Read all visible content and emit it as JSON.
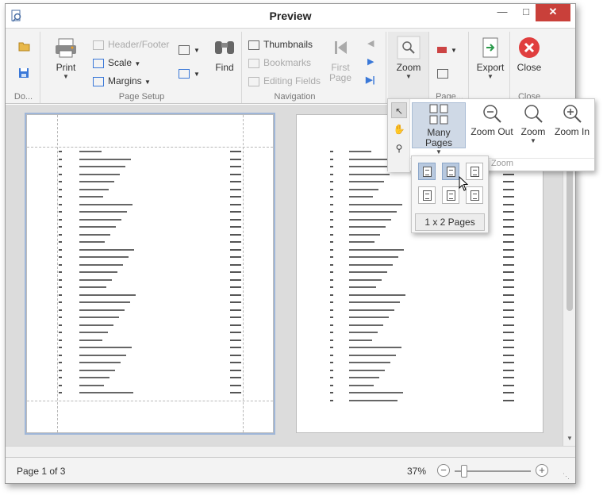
{
  "window": {
    "title": "Preview"
  },
  "ribbon": {
    "groups": {
      "document": "Do...",
      "page_setup": "Page Setup",
      "navigation": "Navigation",
      "page_bg": "Page...",
      "close": "Close"
    },
    "print": "Print",
    "header_footer": "Header/Footer",
    "scale": "Scale",
    "margins": "Margins",
    "find": "Find",
    "thumbnails": "Thumbnails",
    "bookmarks": "Bookmarks",
    "editing_fields": "Editing Fields",
    "first_page_1": "First",
    "first_page_2": "Page",
    "zoom": "Zoom",
    "export": "Export",
    "close": "Close"
  },
  "zoom_popup": {
    "many_pages": "Many Pages",
    "zoom_out": "Zoom Out",
    "zoom": "Zoom",
    "zoom_in": "Zoom In",
    "footer": "Zoom"
  },
  "pages_dropdown": {
    "label": "1 x 2 Pages"
  },
  "status": {
    "page_info": "Page 1 of 3",
    "zoom_percent": "37%"
  },
  "colors": {
    "close_red": "#c9403a",
    "selection": "#cfd9e6",
    "accent_blue": "#3a78d8"
  }
}
